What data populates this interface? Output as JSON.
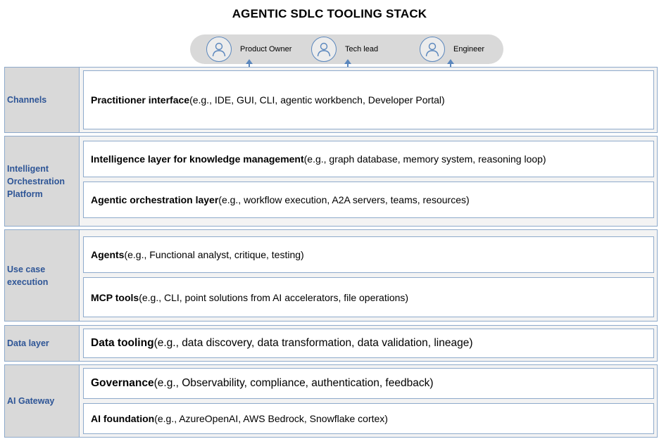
{
  "title": "AGENTIC SDLC TOOLING STACK",
  "personas": [
    {
      "label": "Product Owner",
      "icon": "person-icon"
    },
    {
      "label": "Tech lead",
      "icon": "person-icon"
    },
    {
      "label": "Engineer",
      "icon": "person-icon"
    }
  ],
  "sections": [
    {
      "label": "Channels",
      "layers": [
        {
          "name": "Practitioner interface",
          "examples": " (e.g., IDE, GUI, CLI, agentic workbench, Developer Portal)"
        }
      ]
    },
    {
      "label": "Intelligent Orchestration Platform",
      "layers": [
        {
          "name": "Intelligence layer for knowledge management",
          "examples": " (e.g., graph database, memory system, reasoning loop)"
        },
        {
          "name": "Agentic orchestration layer",
          "examples": " (e.g., workflow execution, A2A servers, teams, resources)"
        }
      ]
    },
    {
      "label": "Use case execution",
      "layers": [
        {
          "name": "Agents",
          "examples": " (e.g., Functional analyst, critique, testing)"
        },
        {
          "name": "MCP tools",
          "examples": " (e.g., CLI, point solutions from AI accelerators, file operations)"
        }
      ]
    },
    {
      "label": "Data layer",
      "layers": [
        {
          "name": "Data tooling",
          "examples": " (e.g., data discovery, data transformation, data validation, lineage)"
        }
      ]
    },
    {
      "label": "AI Gateway",
      "layers": [
        {
          "name": "Governance",
          "examples": " (e.g., Observability, compliance, authentication, feedback)"
        },
        {
          "name": "AI foundation",
          "examples": " (e.g., AzureOpenAI, AWS Bedrock, Snowflake cortex)"
        }
      ]
    }
  ],
  "colors": {
    "label_text": "#2e5596",
    "border": "#8eaacb",
    "arrow": "#5b87bd",
    "label_bg": "#d9d9d9"
  }
}
